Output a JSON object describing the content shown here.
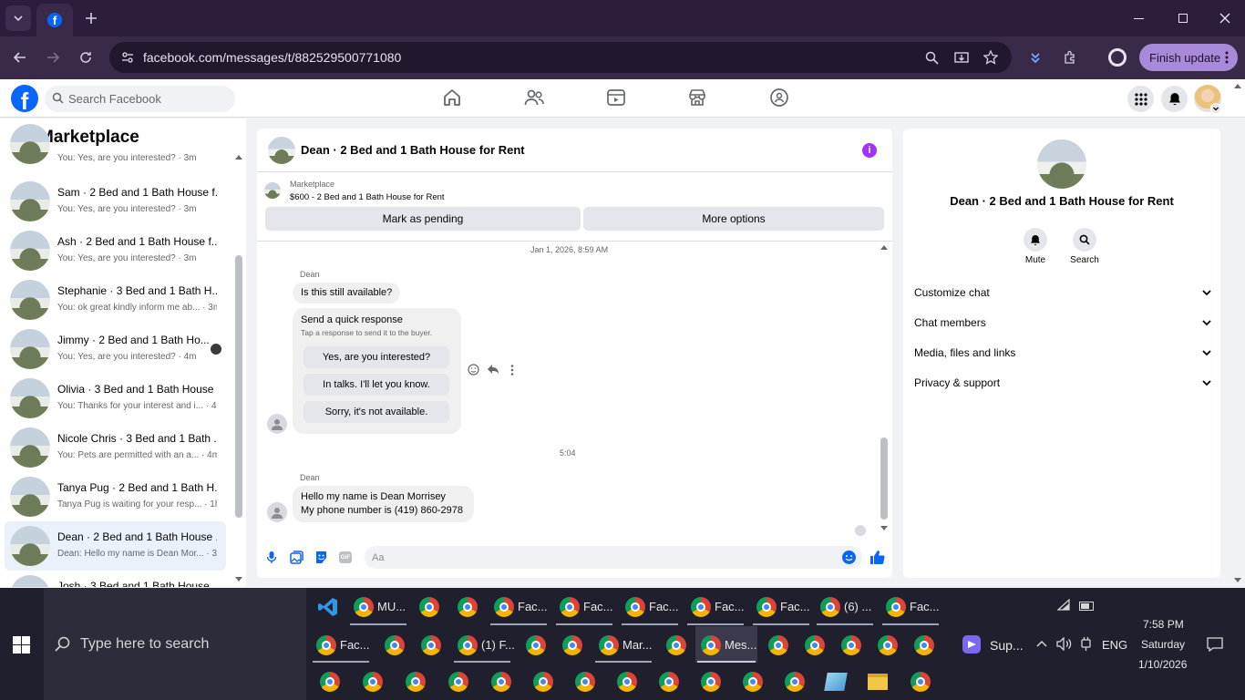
{
  "browser": {
    "url": "facebook.com/messages/t/882529500771080",
    "finish_update": "Finish update",
    "accent": "#a98ad8"
  },
  "fb": {
    "search_placeholder": "Search Facebook",
    "brand_color": "#0866ff"
  },
  "left_panel": {
    "title": "Marketplace",
    "chats": [
      {
        "name": "",
        "snippet": "You: Yes, are you interested? · 3m"
      },
      {
        "name": "Sam · 2 Bed and 1 Bath House f...",
        "snippet": "You: Yes, are you interested? · 3m"
      },
      {
        "name": "Ash · 2 Bed and 1 Bath House f...",
        "snippet": "You: Yes, are you interested? · 3m"
      },
      {
        "name": "Stephanie · 3 Bed and 1 Bath H...",
        "snippet": "You: ok great kindly inform me ab... · 3m"
      },
      {
        "name": "Jimmy · 2 Bed and 1 Bath Ho...",
        "snippet": "You: Yes, are you interested? · 4m"
      },
      {
        "name": "Olivia · 3 Bed and 1 Bath House ...",
        "snippet": "You: Thanks for your interest and i... · 4m"
      },
      {
        "name": "Nicole Chris · 3 Bed and 1 Bath ...",
        "snippet": "You: Pets are permitted with an a... · 4m"
      },
      {
        "name": "Tanya Pug · 2 Bed and 1 Bath H...",
        "snippet": "Tanya Pug is waiting for your resp... · 1h"
      },
      {
        "name": "Dean · 2 Bed and 1 Bath House ...",
        "snippet": "Dean: Hello my name is Dean Mor... · 3h"
      },
      {
        "name": "Josh · 3 Bed and 1 Bath House...",
        "snippet": ""
      }
    ]
  },
  "chat": {
    "title": "Dean · 2 Bed and 1 Bath House for Rent",
    "listing_source": "Marketplace",
    "listing_title": "$600 - 2 Bed and 1 Bath House for Rent",
    "mark_pending": "Mark as pending",
    "more_options": "More options",
    "timestamp1": "Jan 1, 2026, 8:59 AM",
    "sender1": "Dean",
    "msg1": "Is this still available?",
    "quick_title": "Send a quick response",
    "quick_sub": "Tap a response to send it to the buyer.",
    "quick_responses": [
      "Yes, are you interested?",
      "In talks. I'll let you know.",
      "Sorry, it's not available."
    ],
    "timestamp2": "5:04",
    "sender2": "Dean",
    "msg2_line1": "Hello my name is Dean Morrisey",
    "msg2_line2": "My phone number is (419) 860-2978",
    "composer_placeholder": "Aa"
  },
  "info": {
    "name": "Dean · 2 Bed and 1 Bath House for Rent",
    "mute": "Mute",
    "search": "Search",
    "sections": [
      "Customize chat",
      "Chat members",
      "Media, files and links",
      "Privacy & support"
    ]
  },
  "taskbar": {
    "search_placeholder": "Type here to search",
    "row1_labels": [
      "MU...",
      "Fac...",
      "Fac...",
      "Fac...",
      "Fac...",
      "Fac...",
      "(6) ...",
      "Fac..."
    ],
    "row2_labels": [
      "Fac...",
      "(1) F...",
      "Mar...",
      "Mes..."
    ],
    "sup_label": "Sup...",
    "lang": "ENG",
    "time": "7:58 PM",
    "day": "Saturday",
    "date": "1/10/2026"
  }
}
